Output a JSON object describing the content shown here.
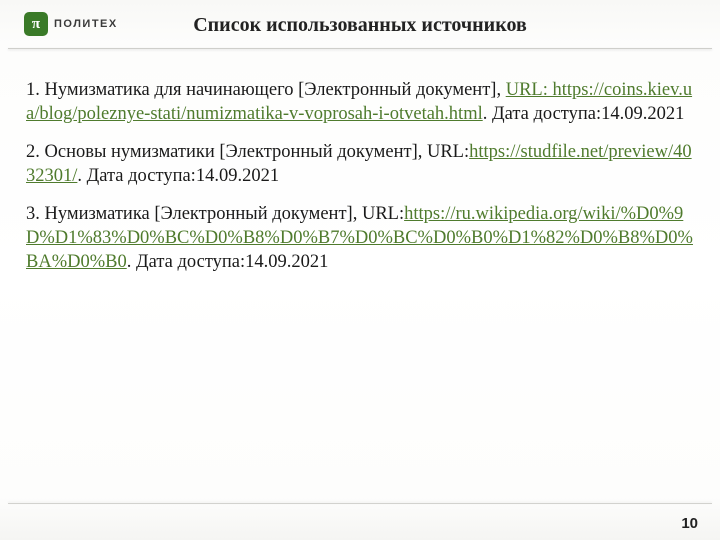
{
  "header": {
    "logo_glyph": "π",
    "logo_text": "ПОЛИТЕХ",
    "title": "Список использованных источников"
  },
  "refs": [
    {
      "prefix": "1. Нумизматика для начинающего [Электронный документ], ",
      "link_text": "URL: https://coins.kiev.ua/blog/poleznye-stati/numizmatika-v-voprosah-i-otvetah.html",
      "suffix": ". Дата доступа:14.09.2021"
    },
    {
      "prefix": "2. Основы нумизматики [Электронный документ], URL:",
      "link_text": "https://studfile.net/preview/4032301/",
      "suffix": ". Дата доступа:14.09.2021"
    },
    {
      "prefix": "3. Нумизматика [Электронный документ], URL:",
      "link_text": "https://ru.wikipedia.org/wiki/%D0%9D%D1%83%D0%BC%D0%B8%D0%B7%D0%BC%D0%B0%D1%82%D0%B8%D0%BA%D0%B0",
      "suffix": ". Дата доступа:14.09.2021"
    }
  ],
  "page_number": "10"
}
